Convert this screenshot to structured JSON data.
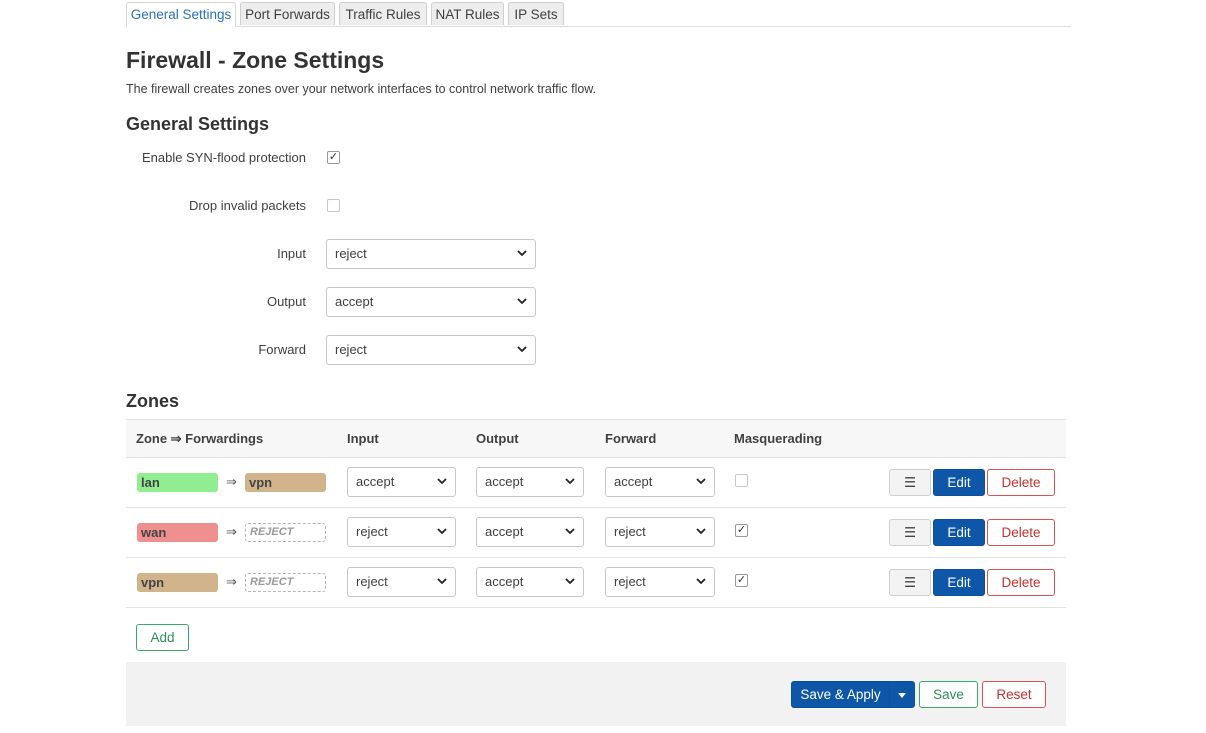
{
  "tabs": [
    {
      "label": "General Settings",
      "active": true
    },
    {
      "label": "Port Forwards",
      "active": false
    },
    {
      "label": "Traffic Rules",
      "active": false
    },
    {
      "label": "NAT Rules",
      "active": false
    },
    {
      "label": "IP Sets",
      "active": false
    }
  ],
  "page": {
    "title": "Firewall - Zone Settings",
    "description": "The firewall creates zones over your network interfaces to control network traffic flow."
  },
  "general": {
    "heading": "General Settings",
    "syn_flood": {
      "label": "Enable SYN-flood protection",
      "checked": true
    },
    "drop_invalid": {
      "label": "Drop invalid packets",
      "checked": false
    },
    "input": {
      "label": "Input",
      "value": "reject"
    },
    "output": {
      "label": "Output",
      "value": "accept"
    },
    "forward": {
      "label": "Forward",
      "value": "reject"
    }
  },
  "zones": {
    "heading": "Zones",
    "columns": {
      "zone": "Zone ⇒ Forwardings",
      "input": "Input",
      "output": "Output",
      "forward": "Forward",
      "masq": "Masquerading"
    },
    "rows": [
      {
        "name": "lan",
        "color": "#90ee90",
        "arrow": "⇒",
        "target": "vpn",
        "target_color": "#d2b48c",
        "input": "accept",
        "output": "accept",
        "forward": "accept",
        "masq": false
      },
      {
        "name": "wan",
        "color": "#f08f8f",
        "arrow": "⇒",
        "target": "REJECT",
        "target_color": "",
        "input": "reject",
        "output": "accept",
        "forward": "reject",
        "masq": true
      },
      {
        "name": "vpn",
        "color": "#d2b48c",
        "arrow": "⇒",
        "target": "REJECT",
        "target_color": "",
        "input": "reject",
        "output": "accept",
        "forward": "reject",
        "masq": true
      }
    ],
    "row_actions": {
      "menu": "☰",
      "edit": "Edit",
      "delete": "Delete"
    },
    "add_label": "Add"
  },
  "footer": {
    "save_apply": "Save & Apply",
    "save": "Save",
    "reset": "Reset"
  },
  "colors": {
    "accent": "#0e56a8",
    "positive": "#2e8f57",
    "negative": "#c9302c"
  }
}
